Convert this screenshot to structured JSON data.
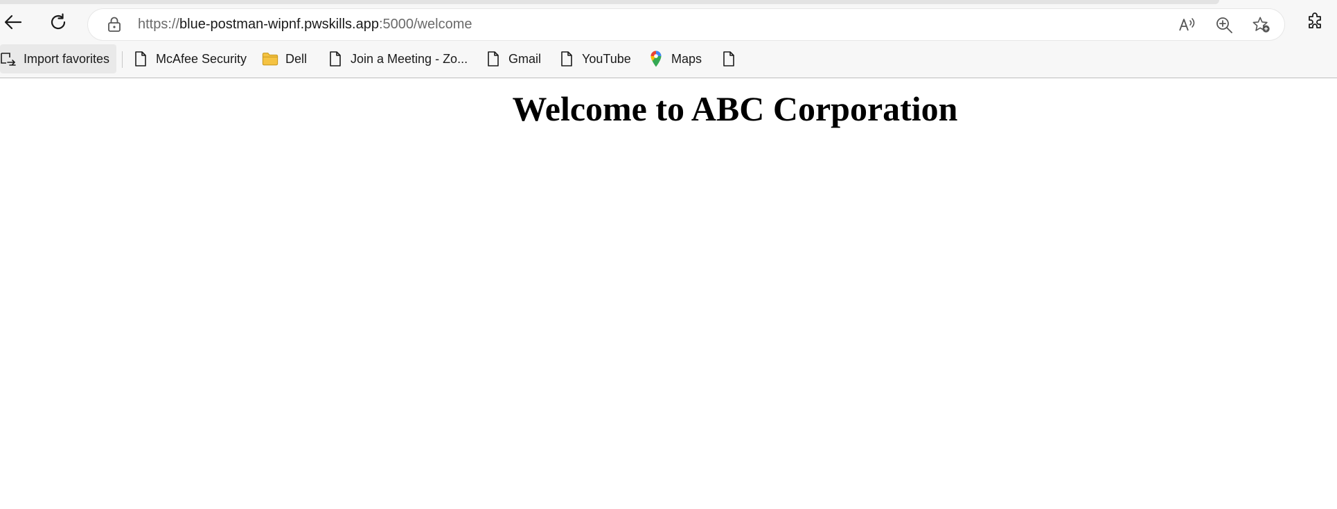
{
  "browser": {
    "address_bar": {
      "url_scheme": "https://",
      "url_host": "blue-postman-wipnf.pwskills.app",
      "url_rest": ":5000/welcome"
    },
    "toolbar_icons": [
      "back-arrow-icon",
      "refresh-icon",
      "lock-icon",
      "read-aloud-icon",
      "zoom-in-icon",
      "add-favorite-icon",
      "extensions-icon"
    ],
    "bookmarks": [
      {
        "label": "Import favorites",
        "icon": "import-favorites-icon"
      },
      {
        "label": "McAfee Security",
        "icon": "page-icon"
      },
      {
        "label": "Dell",
        "icon": "folder-icon"
      },
      {
        "label": "Join a Meeting - Zo...",
        "icon": "page-icon"
      },
      {
        "label": "Gmail",
        "icon": "page-icon"
      },
      {
        "label": "YouTube",
        "icon": "page-icon"
      },
      {
        "label": "Maps",
        "icon": "maps-pin-icon"
      },
      {
        "label": "",
        "icon": "page-icon"
      }
    ]
  },
  "page": {
    "heading": "Welcome to ABC Corporation"
  },
  "colors": {
    "chrome_bg": "#f7f7f7",
    "folder": "#f5c342",
    "page_bg": "#ffffff",
    "text": "#000000"
  }
}
